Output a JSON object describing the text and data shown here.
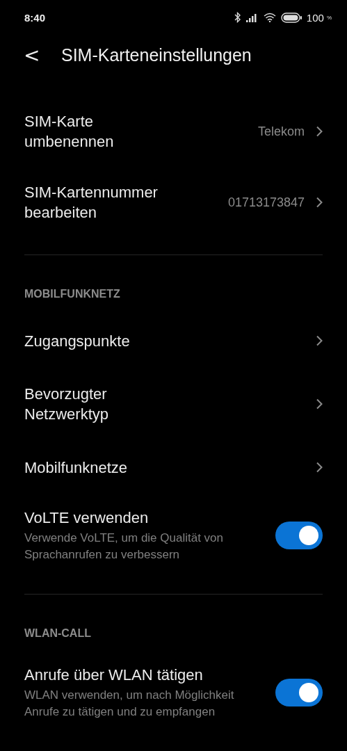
{
  "status_bar": {
    "time": "8:40",
    "battery_text": "100",
    "percent": "%"
  },
  "header": {
    "back": "<",
    "title": "SIM-Karteneinstellungen"
  },
  "sections": [
    {
      "items": [
        {
          "kind": "link",
          "title": "SIM-Karte umbenennen",
          "value": "Telekom"
        },
        {
          "kind": "link",
          "title": "SIM-Kartennummer bearbeiten",
          "value": "01713173847"
        }
      ]
    },
    {
      "header": "MOBILFUNKNETZ",
      "items": [
        {
          "kind": "link",
          "title": "Zugangspunkte"
        },
        {
          "kind": "link",
          "title": "Bevorzugter Netzwerktyp"
        },
        {
          "kind": "link",
          "title": "Mobilfunknetze"
        },
        {
          "kind": "toggle",
          "title": "VoLTE verwenden",
          "subtitle": "Verwende VoLTE, um die Qualität von Sprachanrufen zu verbessern",
          "on": true
        }
      ]
    },
    {
      "header": "WLAN-CALL",
      "items": [
        {
          "kind": "toggle",
          "title": "Anrufe über WLAN tätigen",
          "subtitle": "WLAN verwenden, um nach Möglichkeit Anrufe zu tätigen und zu empfangen",
          "on": true
        }
      ]
    }
  ]
}
